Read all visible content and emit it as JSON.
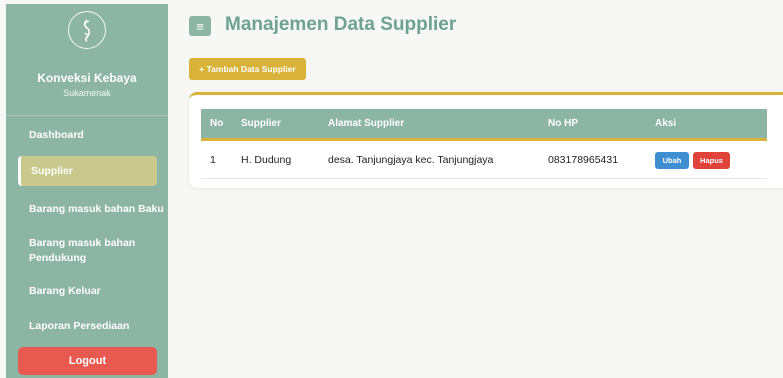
{
  "sidebar": {
    "brand_name": "Konveksi Kebaya",
    "brand_sub": "Sukamenak",
    "items": [
      {
        "label": "Dashboard"
      },
      {
        "label": "Supplier",
        "active": true
      },
      {
        "label": "Barang masuk bahan Baku"
      },
      {
        "label": "Barang masuk bahan Pendukung"
      },
      {
        "label": "Barang Keluar"
      },
      {
        "label": "Laporan Persediaan"
      }
    ],
    "logout_label": "Logout"
  },
  "header": {
    "menu_icon": "≡",
    "title": "Manajemen Data Supplier"
  },
  "toolbar": {
    "add_label": "+ Tambah Data Supplier"
  },
  "table": {
    "columns": [
      "No",
      "Supplier",
      "Alamat Supplier",
      "No HP",
      "Aksi"
    ],
    "rows": [
      {
        "no": "1",
        "supplier": "H. Dudung",
        "alamat": "desa. Tanjungjaya kec. Tanjungjaya",
        "no_hp": "083178965431",
        "edit_label": "Ubah",
        "delete_label": "Hapus"
      }
    ]
  },
  "colors": {
    "sidebar_bg": "#8cb5a3",
    "accent_gold": "#d9b23a",
    "title_green": "#6ea38e",
    "logout_red": "#e85a4f",
    "edit_blue": "#3d8fd1",
    "delete_red": "#e0433a"
  }
}
